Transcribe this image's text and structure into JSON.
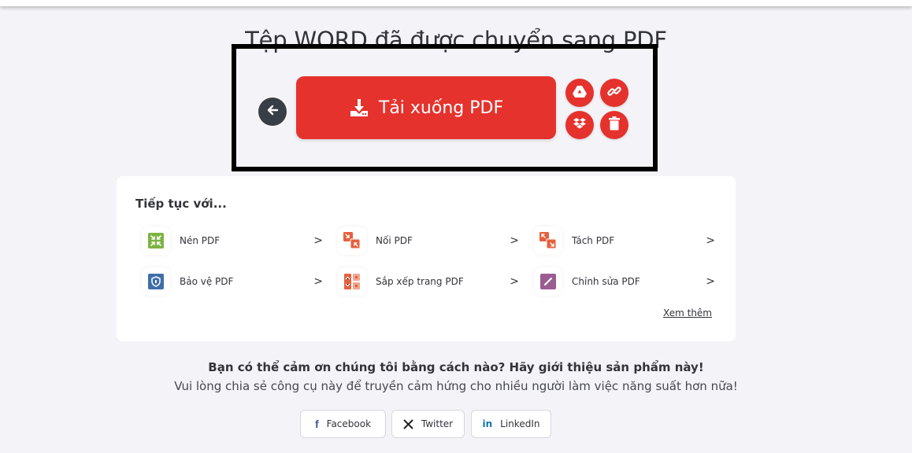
{
  "header": {
    "title": "Tệp WORD đã được chuyển sang PDF"
  },
  "actions": {
    "back_icon": "arrow-left-icon",
    "download_label": "Tải xuống PDF",
    "download_icon": "download-icon",
    "side_buttons": [
      {
        "name": "google-drive",
        "icon": "google-drive-icon"
      },
      {
        "name": "copy-link",
        "icon": "link-icon"
      },
      {
        "name": "dropbox",
        "icon": "dropbox-icon"
      },
      {
        "name": "delete",
        "icon": "trash-icon"
      }
    ],
    "accent_color": "#e5322d"
  },
  "continue": {
    "title": "Tiếp tục với...",
    "tools": [
      {
        "label": "Nén PDF",
        "icon": "compress-icon",
        "color": "#7cb342"
      },
      {
        "label": "Nối PDF",
        "icon": "merge-icon",
        "color": "#e5603d"
      },
      {
        "label": "Tách PDF",
        "icon": "split-icon",
        "color": "#e5603d"
      },
      {
        "label": "Bảo vệ PDF",
        "icon": "shield-icon",
        "color": "#3f6ea8"
      },
      {
        "label": "Sắp xếp trang PDF",
        "icon": "organize-icon",
        "color": "#e5603d"
      },
      {
        "label": "Chỉnh sửa PDF",
        "icon": "edit-icon",
        "color": "#9b5c91"
      }
    ],
    "chevron": ">",
    "more_label": "Xem thêm"
  },
  "share": {
    "heading": "Bạn có thể cảm ơn chúng tôi bằng cách nào? Hãy giới thiệu sản phẩm này!",
    "subtext": "Vui lòng chia sẻ công cụ này để truyền cảm hứng cho nhiều người làm việc năng suất hơn nữa!",
    "buttons": [
      {
        "label": "Facebook",
        "icon": "facebook-icon",
        "glyph": "f"
      },
      {
        "label": "Twitter",
        "icon": "x-icon",
        "glyph": "𝕏"
      },
      {
        "label": "LinkedIn",
        "icon": "linkedin-icon",
        "glyph": "in"
      }
    ]
  }
}
